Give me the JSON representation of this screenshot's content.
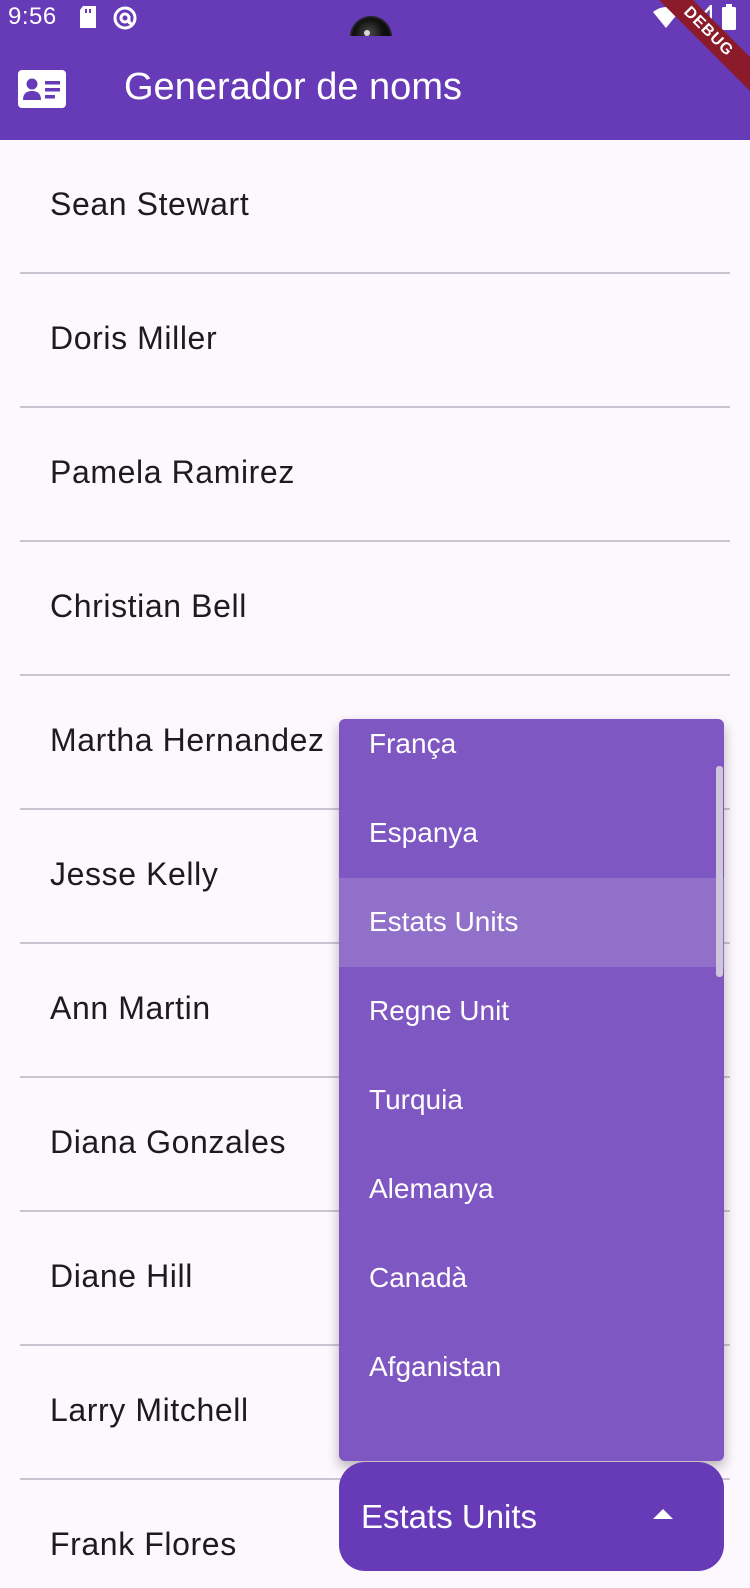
{
  "status_bar": {
    "time": "9:56",
    "icons_left": [
      "sd-card-icon",
      "at-sign-icon"
    ],
    "icons_right": [
      "wifi-icon",
      "signal-icon",
      "battery-icon"
    ]
  },
  "debug_banner": "DEBUG",
  "app_bar": {
    "title": "Generador de noms",
    "icon": "contact-card-icon",
    "background": "#673ab7"
  },
  "names": [
    "Sean Stewart",
    "Doris Miller",
    "Pamela Ramirez",
    "Christian Bell",
    "Martha Hernandez",
    "Jesse Kelly",
    "Ann Martin",
    "Diana Gonzales",
    "Diane Hill",
    "Larry Mitchell",
    "Frank Flores"
  ],
  "country_menu": {
    "options": [
      "França",
      "Espanya",
      "Estats Units",
      "Regne Unit",
      "Turquia",
      "Alemanya",
      "Canadà",
      "Afganistan"
    ],
    "selected": "Estats Units",
    "background": "#7e57c2",
    "selected_background": "#9170ca"
  },
  "country_dropdown": {
    "value": "Estats Units",
    "arrow_icon": "arrow-drop-up-icon",
    "background": "#673ab7"
  }
}
